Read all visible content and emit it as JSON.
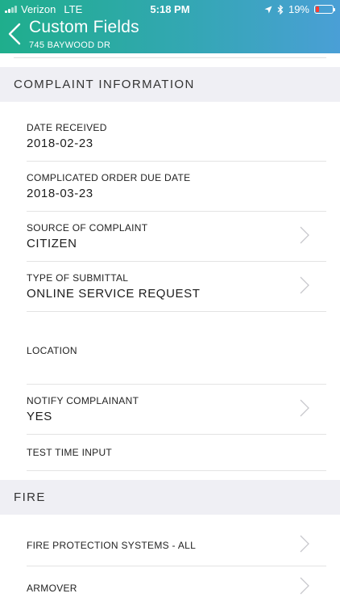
{
  "status_bar": {
    "carrier": "Verizon",
    "network": "LTE",
    "time": "5:18 PM",
    "battery": "19%",
    "battery_level": 0.19
  },
  "nav": {
    "title": "Custom Fields",
    "subtitle": "745 BAYWOOD DR"
  },
  "sections": [
    {
      "title": "COMPLAINT INFORMATION",
      "fields": [
        {
          "label": "DATE RECEIVED",
          "value": "2018-02-23"
        },
        {
          "label": "COMPLICATED ORDER DUE DATE",
          "value": "2018-03-23"
        },
        {
          "label": "SOURCE OF COMPLAINT",
          "value": "CITIZEN"
        },
        {
          "label": "TYPE OF SUBMITTAL",
          "value": "ONLINE SERVICE REQUEST"
        },
        {
          "label": "LOCATION",
          "value": ""
        },
        {
          "label": "NOTIFY COMPLAINANT",
          "value": "YES"
        },
        {
          "label": "TEST TIME INPUT",
          "value": ""
        }
      ]
    },
    {
      "title": "FIRE",
      "fields": [
        {
          "label": "FIRE PROTECTION SYSTEMS - ALL",
          "value": ""
        },
        {
          "label": "ARMOVER",
          "value": ""
        }
      ]
    }
  ],
  "colors": {
    "header_start": "#1fae8c",
    "header_end": "#4a9fd6",
    "battery_low": "#ff3b30",
    "section_bg": "#efeff4"
  }
}
